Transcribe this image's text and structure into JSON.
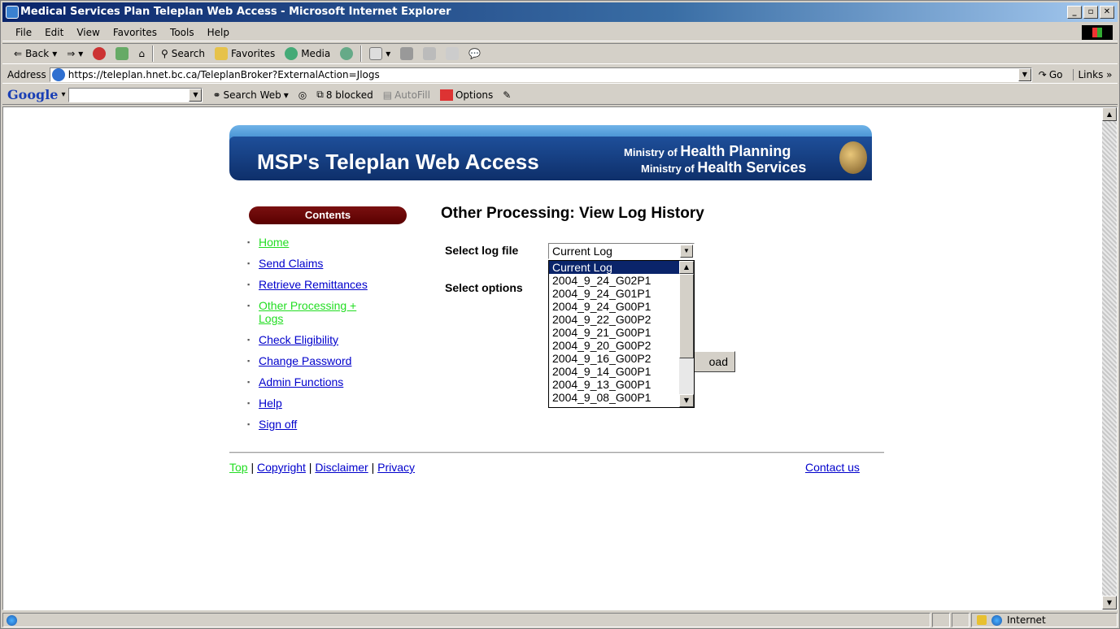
{
  "window": {
    "title": "Medical Services Plan Teleplan Web Access - Microsoft Internet Explorer",
    "buttons": [
      "_",
      "▫",
      "✕"
    ]
  },
  "menubar": [
    "File",
    "Edit",
    "View",
    "Favorites",
    "Tools",
    "Help"
  ],
  "toolbar": {
    "back": "Back",
    "search": "Search",
    "favorites": "Favorites",
    "media": "Media"
  },
  "address": {
    "label": "Address",
    "url": "https://teleplan.hnet.bc.ca/TeleplanBroker?ExternalAction=Jlogs",
    "go": "Go",
    "links": "Links »"
  },
  "googlebar": {
    "logo": "Google",
    "search_web": "Search Web",
    "blocked": "8 blocked",
    "autofill": "AutoFill",
    "options": "Options"
  },
  "banner": {
    "title": "MSP's Teleplan Web Access",
    "ministry1_prefix": "Ministry of",
    "ministry1_name": "Health Planning",
    "ministry2_prefix": "Ministry of",
    "ministry2_name": "Health Services"
  },
  "sidebar": {
    "heading": "Contents",
    "items": [
      {
        "label": "Home"
      },
      {
        "label": "Send Claims"
      },
      {
        "label": "Retrieve Remittances"
      },
      {
        "label": "Other Processing + Logs"
      },
      {
        "label": "Check Eligibility"
      },
      {
        "label": "Change Password"
      },
      {
        "label": "Admin Functions"
      },
      {
        "label": "Help"
      },
      {
        "label": "Sign off"
      }
    ]
  },
  "main": {
    "title": "Other Processing: View Log History",
    "select_log_label": "Select log file",
    "select_log_value": "Current Log",
    "select_options_label": "Select options",
    "download_partial": "oad",
    "log_options": [
      "Current Log",
      "2004_9_24_G02P1",
      "2004_9_24_G01P1",
      "2004_9_24_G00P1",
      "2004_9_22_G00P2",
      "2004_9_21_G00P1",
      "2004_9_20_G00P2",
      "2004_9_16_G00P2",
      "2004_9_14_G00P1",
      "2004_9_13_G00P1",
      "2004_9_08_G00P1"
    ]
  },
  "footer": {
    "top": "Top",
    "copyright": "Copyright",
    "disclaimer": "Disclaimer",
    "privacy": "Privacy",
    "contact": "Contact us"
  },
  "status": {
    "zone": "Internet"
  },
  "colors": {
    "link_visited_green": "#22dd22",
    "link_blue": "#0000cc",
    "contents_pill": "#7a1010",
    "banner_blue": "#1e4f9a"
  }
}
